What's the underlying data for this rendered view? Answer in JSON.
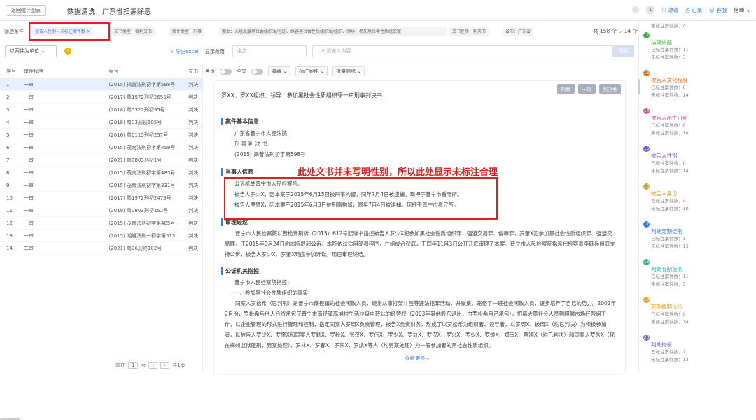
{
  "header": {
    "back_label": "返回统计图表",
    "title": "数据清洗：广东省扫黑除恶",
    "count": "1",
    "invite": "邀请",
    "record": "记录",
    "guide": "客服",
    "user": "佟畴"
  },
  "filters": {
    "label": "筛选条件",
    "tags": [
      {
        "text": "被告人性别 - 未标注案件数 ×",
        "active": true
      },
      {
        "text": "文书类型：裁判文书",
        "active": false
      },
      {
        "text": "案件类型：刑事",
        "active": false
      },
      {
        "text": "案由：入境发展黑社会组织罪/包庇、纵容黑社会性质组织罪/组织、领导、参加黑社会性质组织罪",
        "active": false
      },
      {
        "text": "文书性质：判决书",
        "active": false
      },
      {
        "text": "省市：广东省",
        "active": false
      }
    ],
    "count_text": "共 158 个",
    "filter_count": "14 个"
  },
  "toolbar": {
    "unit_select": "以案件为单位",
    "export": "导出excel",
    "display_label": "显示段落",
    "display_select": "全文",
    "search_placeholder": "请输入内容",
    "search_btn": "搜索",
    "options": {
      "wrap": "黑页",
      "full": "全文",
      "collect": "收藏",
      "annotate": "标注案件",
      "batch_delete": "批量删除"
    }
  },
  "list": {
    "headers": {
      "no": "序号",
      "procedure": "审理程序",
      "case_no": "案号",
      "doc": "文书"
    },
    "rows": [
      {
        "no": "1",
        "proc": "一审",
        "case": "(2015) 揭普法刑初字第598号",
        "doc": "判决"
      },
      {
        "no": "2",
        "proc": "一审",
        "case": "(2017) 粤1972刑初2655号",
        "doc": "判决"
      },
      {
        "no": "3",
        "proc": "一审",
        "case": "(2018) 粤5322刑初95号",
        "doc": "判决"
      },
      {
        "no": "4",
        "proc": "一审",
        "case": "(2018) 粤03刑初105号",
        "doc": "判决"
      },
      {
        "no": "5",
        "proc": "一审",
        "case": "(2016) 粤0115刑初257号",
        "doc": "判决"
      },
      {
        "no": "6",
        "proc": "一审",
        "case": "(2015) 茂南法刑初字第459号",
        "doc": "判决"
      },
      {
        "no": "7",
        "proc": "一审",
        "case": "(2021) 粤0803刑初1号",
        "doc": "判决"
      },
      {
        "no": "8",
        "proc": "一审",
        "case": "(2015) 茂南法刑初字第485号",
        "doc": "判决"
      },
      {
        "no": "9",
        "proc": "一审",
        "case": "(2015) 茂南法刑初字第331号",
        "doc": "判决"
      },
      {
        "no": "10",
        "proc": "一审",
        "case": "(2017) 粤1972刑初2473号",
        "doc": "判决"
      },
      {
        "no": "11",
        "proc": "一审",
        "case": "(2019) 粤0803刑初152号",
        "doc": "判决"
      },
      {
        "no": "12",
        "proc": "一审",
        "case": "(2015) 茂南法刑初字第485号",
        "doc": "判决"
      },
      {
        "no": "13",
        "proc": "一审",
        "case": "(2015) 潮城法刑一初字第513...",
        "doc": "判决"
      },
      {
        "no": "14",
        "proc": "二审",
        "case": "(2021) 粤06刑终102号",
        "doc": "判决"
      }
    ],
    "pager": {
      "prefix": "前往",
      "page": "1",
      "total": "共1页"
    }
  },
  "document": {
    "buttons": [
      "刑事",
      "一审",
      "判决书"
    ],
    "title": "罗XX、罗XX组织、领导、参加黑社会性质组织罪一审刑事判决书",
    "basic_title": "案件基本信息",
    "basic_lines": [
      "广东省普宁市人民法院",
      "刑 事 判 决 书",
      "(2015) 揭普法刑初字第598号"
    ],
    "party_title": "当事人信息",
    "party_lines": [
      "公诉机关普宁市人民检察院。",
      "被告人罗少X，因本案于2015年6月15日被刑事拘留，同年7月4日被逮捕。现押于普宁市看守所。",
      "被告人罗肇X，因本案于2015年6月3日被刑事拘留，同年7月4日被逮捕。现押于普宁市看守所。"
    ],
    "annotation": "此处文书并未写明性别，所以此处显示未标注合理",
    "process_title": "审理经过",
    "process_text": "普宁市人民检察院以普检诉刑诉（2015）612号起诉书指控被告人罗少X犯参加黑社会性质组织罪、强迫交易罪、侵辱罪，罗肇X犯参加黑社会性质组织罪、强迫交易罪，于2015年9月24日向本院提起公诉。本院依法适用简易程序，并组成合议庭，于同年11月3日公开开庭审理了本案。普宁市人民检察院指派代检察员李延兵出庭支持公诉，被告人罗少X、罗肇X到庭参加诉讼。现已审理终结。",
    "claim_title": "公诉机关指控",
    "claim_lines": [
      "普宁市人民检察院指控：",
      "一、参加黑社会性质组织的事实"
    ],
    "claim_text": "同案人罗松希（已判刑）是普宁市南径镇的社会闲散人员，经常从事打架斗殴等违法犯罪活动，并聚集、笼络了一班社会闲散人员，逐步培养了自己的势力。2002年2月份，罗松希与他人合资承包了普宁市南径镇高埔村生活垃圾中转站的经营权（2003年其他股东退出，由罗松希自己承包），招募大量社会人员到麒麟市场经营组工作，以企业管理的形式进行管理和控制，指定同案人罗周X负责管理，被告X负责财务，形成了以罗松希为组织者、领导者，以罗周X、被周X（均已判决）为积极参加者，以被告人罗少X、罗肇X和同案人罗勤X、罗秋X、张汉X、罗伟X、罗少X、罗益X、罗汉X、罗兴X、罗少X、罗焕X、郑南X、蔡德X（均已判决）和同案人罗秀X（现在梅州监狱服刑，另案处理）、罗林X、罗春X、罗东X、罗焕X等人（均另案处理）为一般参加者的黑社会性质组织。",
    "more": "查看更多"
  },
  "right_panel": {
    "items": [
      {
        "num": "",
        "name": "",
        "lines": [
          "未标注案件数：0"
        ],
        "color": "#cccccc"
      },
      {
        "num": "12",
        "name": "法律依据",
        "lines": [
          "已标注案件数：11",
          "未标注案件数：3"
        ],
        "color": "#43b244"
      },
      {
        "num": "13",
        "name": "被告人文化程度",
        "lines": [
          "已标注案件数：0",
          "未标注案件数：14"
        ],
        "color": "#e8742a"
      },
      {
        "num": "14",
        "name": "被告人出生日期",
        "lines": [
          "已标注案件数：0",
          "未标注案件数：14"
        ],
        "color": "#d1578e"
      },
      {
        "num": "15",
        "name": "被告人性别",
        "lines": [
          "已标注案件数：0",
          "未标注案件数：14"
        ],
        "color": "#7a5bd6"
      },
      {
        "num": "16",
        "name": "被告人身份",
        "lines": [
          "已标注案件数：4",
          "未标注案件数：10"
        ],
        "color": "#c9a227"
      },
      {
        "num": "17",
        "name": "判处无期徒刑",
        "lines": [
          "已标注案件数：1",
          "未标注案件数：13"
        ],
        "color": "#3b7de9"
      },
      {
        "num": "18",
        "name": "判处有期徒刑",
        "lines": [
          "已标注案件数：11",
          "未标注案件数：3"
        ],
        "color": "#2bb3b3"
      },
      {
        "num": "19",
        "name": "死刑缓期执行",
        "lines": [
          "已标注案件数：0",
          "未标注案件数：14"
        ],
        "color": "#f0a020"
      },
      {
        "num": "20",
        "name": "判处拘役",
        "lines": [
          "已标注案件数：1",
          "未标注案件数：13"
        ],
        "color": "#6a6ad8"
      }
    ]
  }
}
